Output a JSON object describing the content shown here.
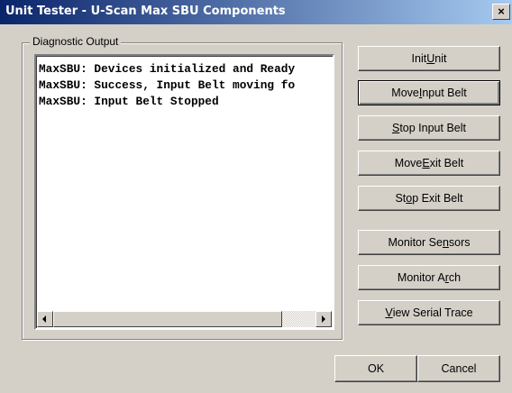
{
  "window": {
    "title": "Unit Tester - U-Scan Max SBU Components",
    "close_glyph": "×"
  },
  "diagnostic": {
    "label": "Diagnostic Output",
    "lines": [
      "MaxSBU: Devices initialized and Ready",
      "MaxSBU: Success, Input Belt moving fo",
      "MaxSBU: Input Belt Stopped"
    ]
  },
  "buttons": [
    {
      "pre": "Init ",
      "key": "U",
      "post": "nit"
    },
    {
      "pre": "Move ",
      "key": "I",
      "post": "nput Belt"
    },
    {
      "pre": "",
      "key": "S",
      "post": "top Input Belt"
    },
    {
      "pre": "Move ",
      "key": "E",
      "post": "xit Belt"
    },
    {
      "pre": "St",
      "key": "o",
      "post": "p Exit Belt"
    },
    {
      "pre": "Monitor Se",
      "key": "n",
      "post": "sors"
    },
    {
      "pre": "Monitor A",
      "key": "r",
      "post": "ch"
    },
    {
      "pre": "",
      "key": "V",
      "post": "iew Serial Trace"
    }
  ],
  "footer": {
    "ok": "OK",
    "cancel": "Cancel"
  }
}
